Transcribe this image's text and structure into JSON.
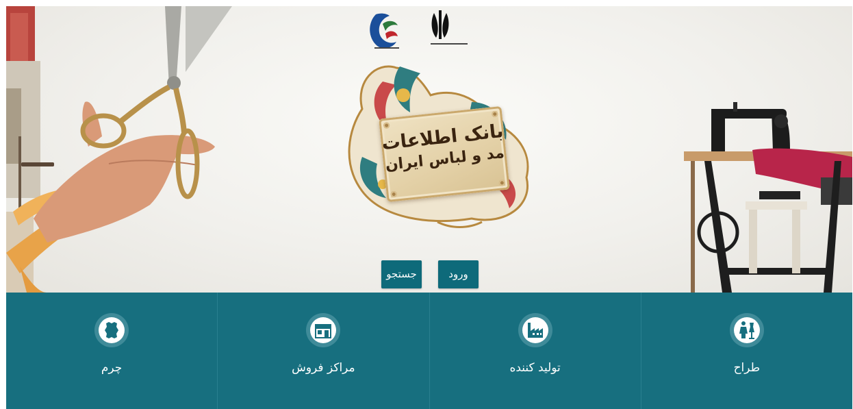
{
  "hero": {
    "title_line1": "بانک اطلاعات",
    "title_line2": "مد و لباس ایران"
  },
  "buttons": {
    "search_label": "جستجو",
    "login_label": "ورود"
  },
  "tiles": [
    {
      "label": "چرم",
      "icon": "leather-icon"
    },
    {
      "label": "مراکز فروش",
      "icon": "storefront-icon"
    },
    {
      "label": "تولید کننده",
      "icon": "factory-icon"
    },
    {
      "label": "طراح",
      "icon": "designer-icon"
    }
  ],
  "colors": {
    "tile_background": "#176f7f",
    "button_background": "#0e6a7a",
    "hero_background": "#f1f0ec"
  }
}
